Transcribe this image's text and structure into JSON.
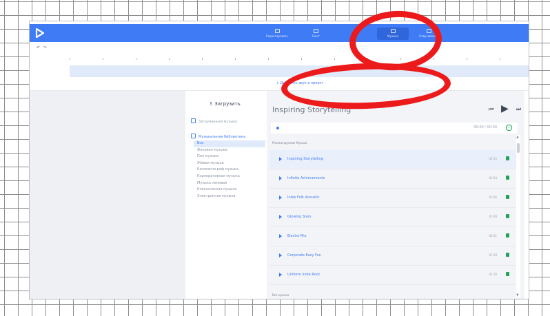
{
  "app": {
    "logo_icon": "play-triangle-icon",
    "brand_color": "#3f7bf5",
    "annotation_color": "#ec1a1a"
  },
  "topnav": {
    "items": [
      {
        "label": "Редактировать",
        "icon": "edit-icon",
        "active": false
      },
      {
        "label": "Текст",
        "icon": "text-icon",
        "active": false
      },
      {
        "label": "Музыка",
        "icon": "music-icon",
        "active": true
      },
      {
        "label": "Озвучивание",
        "icon": "voice-icon",
        "active": false
      }
    ]
  },
  "toolbar": {
    "undo_icon": "undo-icon",
    "redo_icon": "redo-icon"
  },
  "timeline": {
    "add_track_label": "+ Добавить звук в проект"
  },
  "music_menu": {
    "upload_label": "Загрузить",
    "upload_icon": "upload-icon",
    "sources": [
      {
        "label": "Загруженная музыка",
        "icon": "folder-icon",
        "active": false
      },
      {
        "label": "Музыкальная библиотека",
        "icon": "library-icon",
        "active": true
      }
    ],
    "genres": [
      "Все",
      "Фоновая музыка",
      "Поп музыка",
      "Живая музыка",
      "Кинематограф музыка",
      "Корпоративная музыка",
      "Музыка ленивая",
      "Классическая музыка",
      "Электронная музыка"
    ],
    "active_genre": "Все"
  },
  "player": {
    "title": "Inspiring Storytelling",
    "time": "00:00 / 00:00",
    "section_label": "Рекомендуемая Музыка",
    "bottom_section_label": "Все музыка",
    "tracks": [
      {
        "name": "Inspiring Storytelling",
        "duration": "02:15"
      },
      {
        "name": "Infinite Achievements",
        "duration": "01:54"
      },
      {
        "name": "Indie Folk Acoustic",
        "duration": "02:06"
      },
      {
        "name": "Glowing Stars",
        "duration": "01:48"
      },
      {
        "name": "Electro Mix",
        "duration": "02:01"
      },
      {
        "name": "Corporate Easy Fun",
        "duration": "01:58"
      },
      {
        "name": "Uniform Indie Rock",
        "duration": "02:10"
      }
    ]
  }
}
